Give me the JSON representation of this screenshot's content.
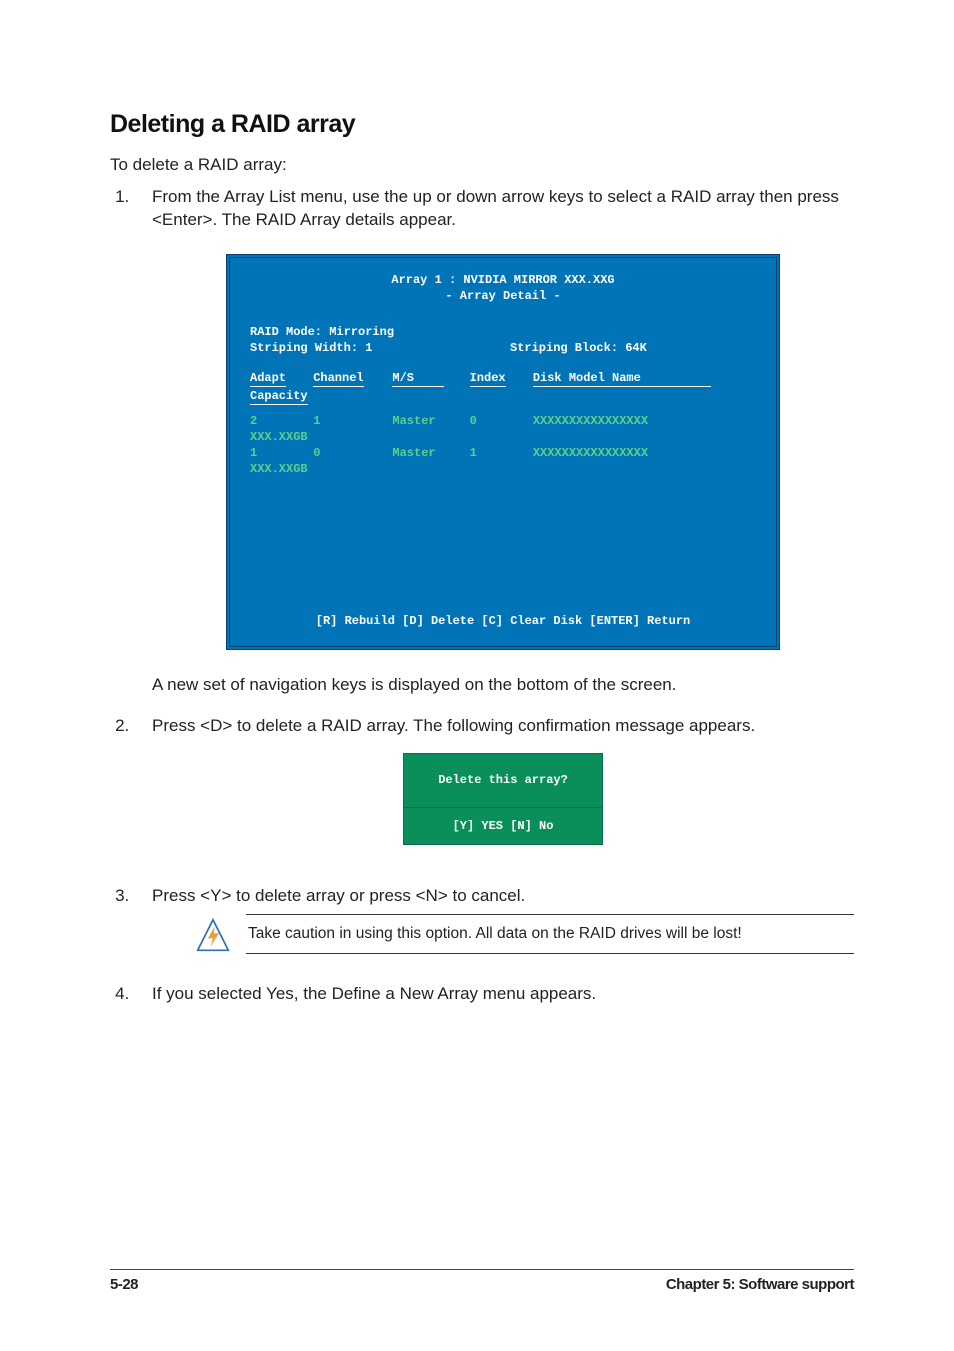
{
  "title": "Deleting a RAID array",
  "intro": "To delete a RAID array:",
  "steps": {
    "1": "From the Array List menu, use the up or down arrow keys to select a RAID array then press <Enter>. The RAID Array details appear.",
    "after_bios": "A new set of  navigation keys is displayed on the bottom of the screen.",
    "2": "Press <D> to delete a RAID array. The following confirmation message appears.",
    "3": "Press <Y> to delete array or press <N> to cancel.",
    "4": "If you selected Yes, the Define a New Array menu appears."
  },
  "bios": {
    "header_line1": "Array 1 : NVIDIA MIRROR  XXX.XXG",
    "header_line2": "- Array Detail -",
    "raid_mode_label": "RAID Mode: Mirroring",
    "striping_width_label": "Striping Width: 1",
    "striping_block_label": "Striping Block: 64K",
    "cols": {
      "adapt": "Adapt",
      "channel": "Channel",
      "ms": "M/S",
      "index": "Index",
      "model": "Disk Model Name",
      "capacity": "Capacity"
    },
    "rows": [
      {
        "adapt": "2",
        "channel": "1",
        "ms": "Master",
        "index": "0",
        "model": "XXXXXXXXXXXXXXXX",
        "capacity": "XXX.XXGB"
      },
      {
        "adapt": "1",
        "channel": "0",
        "ms": "Master",
        "index": "1",
        "model": "XXXXXXXXXXXXXXXX",
        "capacity": "XXX.XXGB"
      }
    ],
    "footer": "[R] Rebuild  [D] Delete  [C] Clear Disk  [ENTER] Return"
  },
  "confirm": {
    "question": "Delete this array?",
    "options": "[Y] YES   [N] No"
  },
  "caution": {
    "text": "Take caution in using this option. All data on the RAID drives will be lost!",
    "icon_name": "caution-bolt-icon"
  },
  "footer": {
    "left": "5-28",
    "right": "Chapter 5: Software support"
  }
}
